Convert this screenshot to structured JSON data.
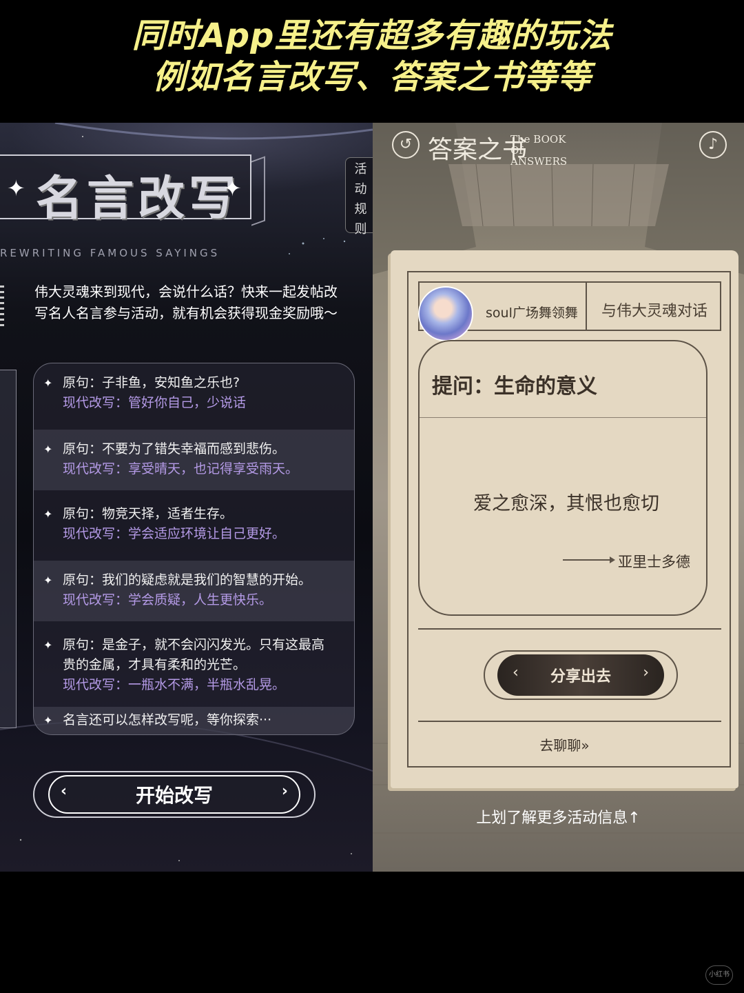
{
  "caption": {
    "line1": "同时App里还有超多有趣的玩法",
    "line2": "例如名言改写、答案之书等等"
  },
  "left": {
    "title": "名言改写",
    "subtitle_en": "REWRITING FAMOUS SAYINGS",
    "rules_tab": [
      "活",
      "动",
      "规",
      "则"
    ],
    "intro": "伟大灵魂来到现代，会说什么话？快来一起发帖改写名人名言参与活动，就有机会获得现金奖励哦～",
    "quotes": [
      {
        "orig": "原句：子非鱼，安知鱼之乐也?",
        "mod": "现代改写：管好你自己，少说话"
      },
      {
        "orig": "原句：不要为了错失幸福而感到悲伤。",
        "mod": "现代改写：享受晴天，也记得享受雨天。"
      },
      {
        "orig": "原句：物竞天择，适者生存。",
        "mod": "现代改写：学会适应环境让自己更好。"
      },
      {
        "orig": "原句：我们的疑虑就是我们的智慧的开始。",
        "mod": "现代改写：学会质疑，人生更快乐。"
      },
      {
        "orig": "原句：是金子，就不会闪闪发光。只有这最高贵的金属，才具有柔和的光芒。",
        "mod": "现代改写：一瓶水不满，半瓶水乱晃。"
      }
    ],
    "more": "名言还可以怎样改写呢，等你探索···",
    "start_button": "开始改写"
  },
  "right": {
    "book_title": "答案之书",
    "book_title_en": "The BOOK Of ANSWERS",
    "user_name": "soul广场舞领舞",
    "talk_title": "与伟大灵魂对话",
    "question": "提问：生命的意义",
    "answer": "爱之愈深，其恨也愈切",
    "author": "亚里士多德",
    "share_button": "分享出去",
    "chat_link": "去聊聊",
    "swipe_hint": "上划了解更多活动信息↑"
  },
  "watermark": "小红书",
  "icons": [
    "back-icon",
    "music-icon",
    "sparkle-icon",
    "chevron-left-icon",
    "chevron-right-icon"
  ]
}
